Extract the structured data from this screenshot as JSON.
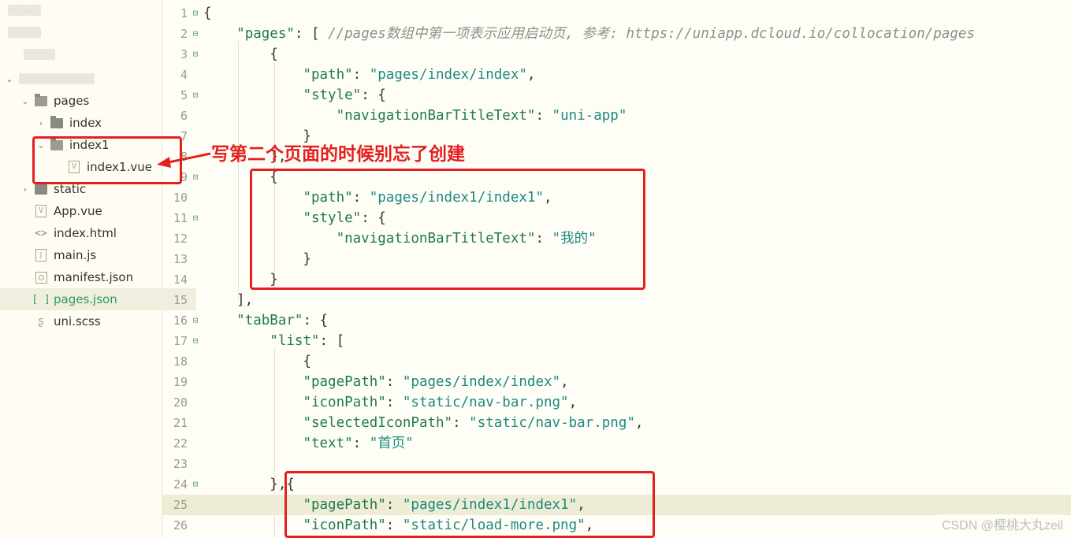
{
  "sidebar": {
    "root_toggle": "⌄",
    "items": [
      {
        "label": "pages",
        "chevron": "⌄",
        "icon": "folder-open-icon"
      },
      {
        "label": "index",
        "chevron": "›",
        "icon": "folder-icon"
      },
      {
        "label": "index1",
        "chevron": "⌄",
        "icon": "folder-open-icon"
      },
      {
        "label": "index1.vue",
        "chevron": "",
        "icon": "vue-file-icon",
        "icon_text": "V"
      },
      {
        "label": "static",
        "chevron": "›",
        "icon": "folder-icon"
      },
      {
        "label": "App.vue",
        "chevron": "",
        "icon": "vue-file-icon",
        "icon_text": "V"
      },
      {
        "label": "index.html",
        "chevron": "",
        "icon": "html-file-icon",
        "icon_text": "<>"
      },
      {
        "label": "main.js",
        "chevron": "",
        "icon": "js-file-icon",
        "icon_text": "J"
      },
      {
        "label": "manifest.json",
        "chevron": "",
        "icon": "settings-file-icon"
      },
      {
        "label": "pages.json",
        "chevron": "",
        "icon": "json-file-icon",
        "icon_text": "[ ]"
      },
      {
        "label": "uni.scss",
        "chevron": "",
        "icon": "scss-file-icon",
        "icon_text": "ʂ"
      }
    ]
  },
  "editor": {
    "lines": [
      {
        "n": "1",
        "tokens": [
          [
            "p",
            "{"
          ]
        ]
      },
      {
        "n": "2",
        "tokens": [
          [
            "p",
            "    "
          ],
          [
            "k",
            "\"pages\""
          ],
          [
            "p",
            ": [ "
          ],
          [
            "c",
            "//pages数组中第一项表示应用启动页, 参考: https://uniapp.dcloud.io/collocation/pages"
          ]
        ]
      },
      {
        "n": "3",
        "tokens": [
          [
            "p",
            "        {"
          ]
        ]
      },
      {
        "n": "4",
        "tokens": [
          [
            "p",
            "            "
          ],
          [
            "k",
            "\"path\""
          ],
          [
            "p",
            ": "
          ],
          [
            "s",
            "\"pages/index/index\""
          ],
          [
            "p",
            ","
          ]
        ]
      },
      {
        "n": "5",
        "tokens": [
          [
            "p",
            "            "
          ],
          [
            "k",
            "\"style\""
          ],
          [
            "p",
            ": {"
          ]
        ]
      },
      {
        "n": "6",
        "tokens": [
          [
            "p",
            "                "
          ],
          [
            "k",
            "\"navigationBarTitleText\""
          ],
          [
            "p",
            ": "
          ],
          [
            "s",
            "\"uni-app\""
          ]
        ]
      },
      {
        "n": "7",
        "tokens": [
          [
            "p",
            "            }"
          ]
        ]
      },
      {
        "n": "8",
        "tokens": [
          [
            "p",
            "        },"
          ]
        ]
      },
      {
        "n": "9",
        "tokens": [
          [
            "p",
            "        {"
          ]
        ]
      },
      {
        "n": "10",
        "tokens": [
          [
            "p",
            "            "
          ],
          [
            "k",
            "\"path\""
          ],
          [
            "p",
            ": "
          ],
          [
            "s",
            "\"pages/index1/index1\""
          ],
          [
            "p",
            ","
          ]
        ]
      },
      {
        "n": "11",
        "tokens": [
          [
            "p",
            "            "
          ],
          [
            "k",
            "\"style\""
          ],
          [
            "p",
            ": {"
          ]
        ]
      },
      {
        "n": "12",
        "tokens": [
          [
            "p",
            "                "
          ],
          [
            "k",
            "\"navigationBarTitleText\""
          ],
          [
            "p",
            ": "
          ],
          [
            "s",
            "\"我的\""
          ]
        ]
      },
      {
        "n": "13",
        "tokens": [
          [
            "p",
            "            }"
          ]
        ]
      },
      {
        "n": "14",
        "tokens": [
          [
            "p",
            "        }"
          ]
        ]
      },
      {
        "n": "15",
        "tokens": [
          [
            "p",
            "    ],"
          ]
        ]
      },
      {
        "n": "16",
        "tokens": [
          [
            "p",
            "    "
          ],
          [
            "k",
            "\"tabBar\""
          ],
          [
            "p",
            ": {"
          ]
        ]
      },
      {
        "n": "17",
        "tokens": [
          [
            "p",
            "        "
          ],
          [
            "k",
            "\"list\""
          ],
          [
            "p",
            ": ["
          ]
        ]
      },
      {
        "n": "18",
        "tokens": [
          [
            "p",
            "            {"
          ]
        ]
      },
      {
        "n": "19",
        "tokens": [
          [
            "p",
            "            "
          ],
          [
            "k",
            "\"pagePath\""
          ],
          [
            "p",
            ": "
          ],
          [
            "s",
            "\"pages/index/index\""
          ],
          [
            "p",
            ","
          ]
        ]
      },
      {
        "n": "20",
        "tokens": [
          [
            "p",
            "            "
          ],
          [
            "k",
            "\"iconPath\""
          ],
          [
            "p",
            ": "
          ],
          [
            "s",
            "\"static/nav-bar.png\""
          ],
          [
            "p",
            ","
          ]
        ]
      },
      {
        "n": "21",
        "tokens": [
          [
            "p",
            "            "
          ],
          [
            "k",
            "\"selectedIconPath\""
          ],
          [
            "p",
            ": "
          ],
          [
            "s",
            "\"static/nav-bar.png\""
          ],
          [
            "p",
            ","
          ]
        ]
      },
      {
        "n": "22",
        "tokens": [
          [
            "p",
            "            "
          ],
          [
            "k",
            "\"text\""
          ],
          [
            "p",
            ": "
          ],
          [
            "s",
            "\"首页\""
          ]
        ]
      },
      {
        "n": "23",
        "tokens": [
          [
            "p",
            ""
          ]
        ]
      },
      {
        "n": "24",
        "tokens": [
          [
            "p",
            "        },{"
          ]
        ]
      },
      {
        "n": "25",
        "tokens": [
          [
            "p",
            "            "
          ],
          [
            "k",
            "\"pagePath\""
          ],
          [
            "p",
            ": "
          ],
          [
            "s",
            "\"pages/index1/index1\""
          ],
          [
            "p",
            ","
          ]
        ]
      },
      {
        "n": "26",
        "tokens": [
          [
            "p",
            "            "
          ],
          [
            "k",
            "\"iconPath\""
          ],
          [
            "p",
            ": "
          ],
          [
            "s",
            "\"static/load-more.png\""
          ],
          [
            "p",
            ","
          ]
        ]
      }
    ],
    "foldable": [
      "1",
      "2",
      "3",
      "5",
      "9",
      "11",
      "16",
      "17",
      "24"
    ],
    "highlight_line": "25"
  },
  "annotation": {
    "text": "写第二个页面的时候别忘了创建",
    "color": "#e32020"
  },
  "watermark": "CSDN @樱桃大丸zeil"
}
